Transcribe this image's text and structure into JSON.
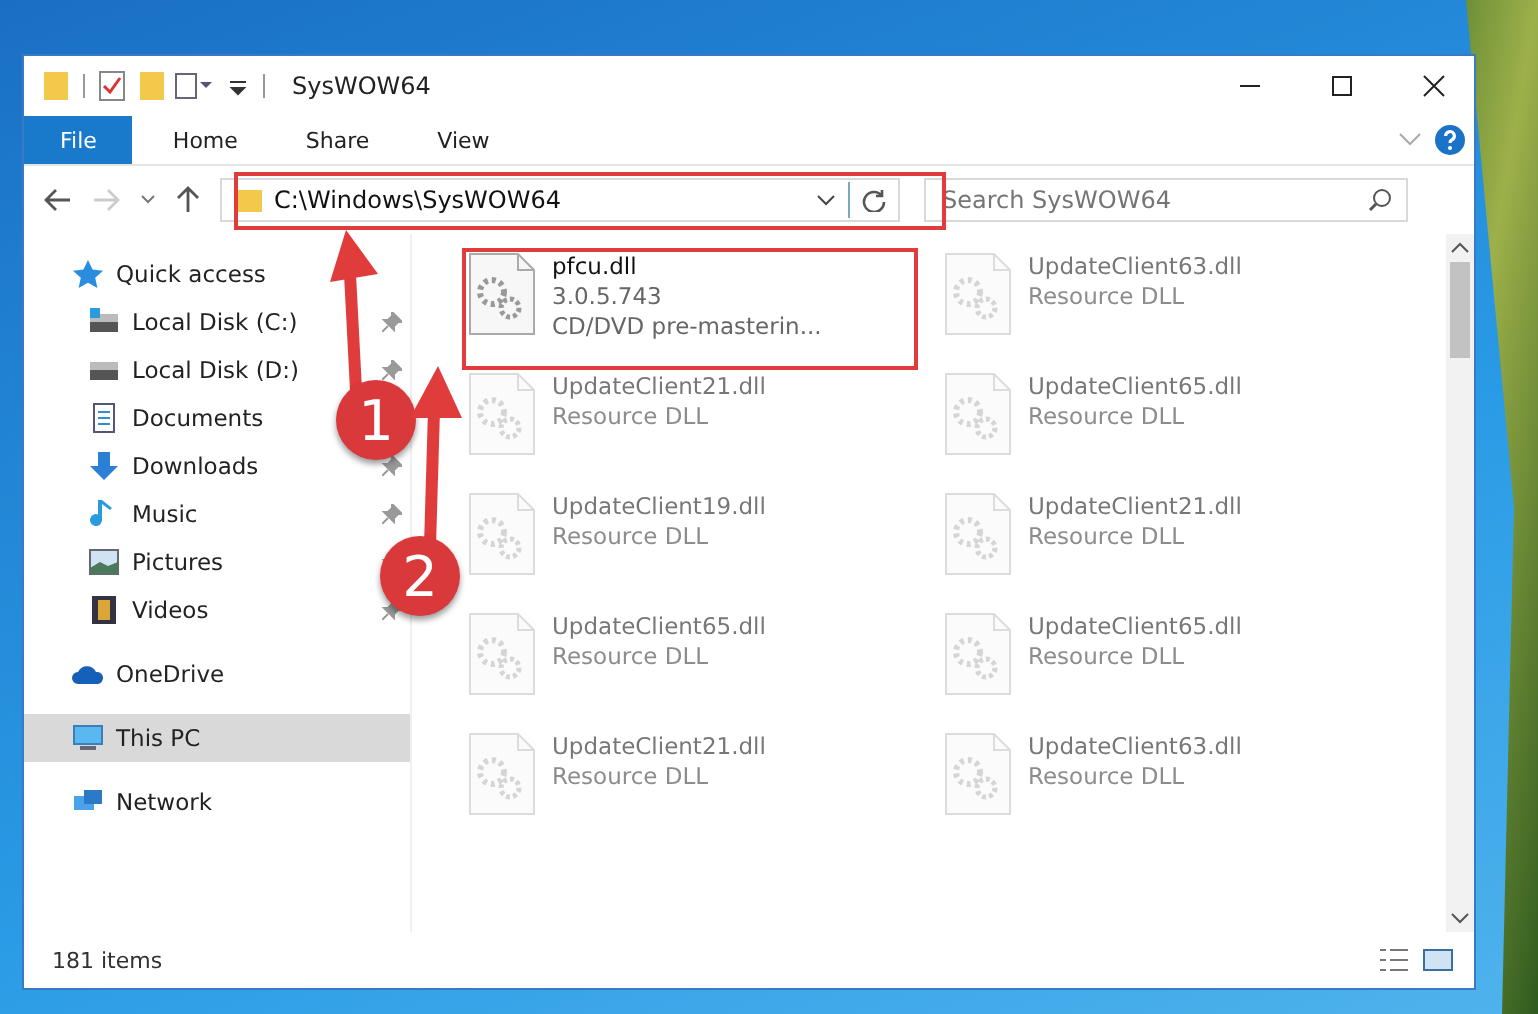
{
  "window": {
    "title": "SysWOW64"
  },
  "ribbon_tabs": [
    {
      "label": "File",
      "selected": true
    },
    {
      "label": "Home",
      "selected": false
    },
    {
      "label": "Share",
      "selected": false
    },
    {
      "label": "View",
      "selected": false
    }
  ],
  "address_bar": {
    "path": "C:\\Windows\\SysWOW64"
  },
  "search": {
    "placeholder": "Search SysWOW64"
  },
  "sidebar": {
    "items": [
      {
        "label": "Quick access",
        "selected": false,
        "children": [
          {
            "label": "Local Disk (C:)",
            "pinned": true
          },
          {
            "label": "Local Disk (D:)",
            "pinned": true
          },
          {
            "label": "Documents",
            "pinned": false
          },
          {
            "label": "Downloads",
            "pinned": true
          },
          {
            "label": "Music",
            "pinned": true
          },
          {
            "label": "Pictures",
            "pinned": true
          },
          {
            "label": "Videos",
            "pinned": true
          }
        ]
      },
      {
        "label": "OneDrive",
        "selected": false
      },
      {
        "label": "This PC",
        "selected": true
      },
      {
        "label": "Network",
        "selected": false
      }
    ]
  },
  "files": [
    {
      "name": "pfcu.dll",
      "version": "3.0.5.743",
      "description": "CD/DVD pre-masterin...",
      "blurred": false
    },
    {
      "name": "UpdateClient63.dll",
      "description": "Resource DLL",
      "blurred": true
    },
    {
      "name": "UpdateClient21.dll",
      "description": "Resource DLL",
      "blurred": true
    },
    {
      "name": "UpdateClient65.dll",
      "description": "Resource DLL",
      "blurred": true
    },
    {
      "name": "UpdateClient19.dll",
      "description": "Resource DLL",
      "blurred": true
    },
    {
      "name": "UpdateClient21.dll",
      "description": "Resource DLL",
      "blurred": true
    },
    {
      "name": "UpdateClient65.dll",
      "description": "Resource DLL",
      "blurred": true
    },
    {
      "name": "UpdateClient65.dll",
      "description": "Resource DLL",
      "blurred": true
    },
    {
      "name": "UpdateClient21.dll",
      "description": "Resource DLL",
      "blurred": true
    },
    {
      "name": "UpdateClient63.dll",
      "description": "Resource DLL",
      "blurred": true
    }
  ],
  "status_bar": {
    "count": "181 items"
  },
  "annotations": [
    {
      "number": "1"
    },
    {
      "number": "2"
    }
  ]
}
